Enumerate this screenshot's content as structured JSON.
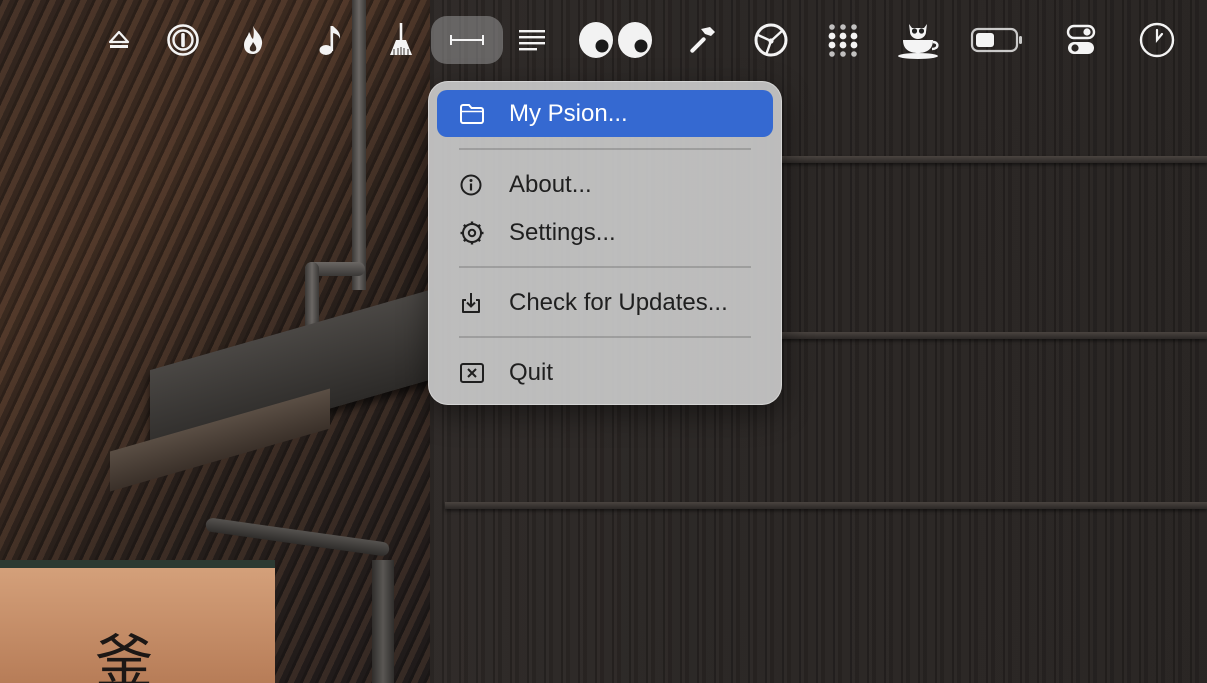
{
  "menubar": {
    "icons": [
      {
        "name": "eject-icon"
      },
      {
        "name": "password-manager-icon"
      },
      {
        "name": "flame-icon"
      },
      {
        "name": "music-note-icon"
      },
      {
        "name": "broom-icon"
      },
      {
        "name": "horizontal-arrows-icon",
        "active": true
      },
      {
        "name": "text-lines-icon"
      },
      {
        "name": "googly-eyes-icon"
      },
      {
        "name": "hammer-icon"
      },
      {
        "name": "network-globe-icon"
      },
      {
        "name": "dots-grid-icon"
      },
      {
        "name": "owl-coffee-cup-icon"
      },
      {
        "name": "battery-icon"
      },
      {
        "name": "toggle-switches-icon"
      },
      {
        "name": "clock-icon"
      }
    ]
  },
  "menu": {
    "items": [
      {
        "label": "My Psion...",
        "icon": "folder-icon",
        "highlighted": true
      },
      {
        "label": "About...",
        "icon": "info-icon"
      },
      {
        "label": "Settings...",
        "icon": "gear-icon"
      },
      {
        "label": "Check for Updates...",
        "icon": "download-tray-icon"
      },
      {
        "label": "Quit",
        "icon": "close-box-icon"
      }
    ]
  },
  "colors": {
    "highlight": "#3569d1",
    "menu_background": "#c8c8c8",
    "menubar_icon": "#f4f4f4"
  },
  "wallpaper": {
    "sign_glyph": "釜"
  }
}
